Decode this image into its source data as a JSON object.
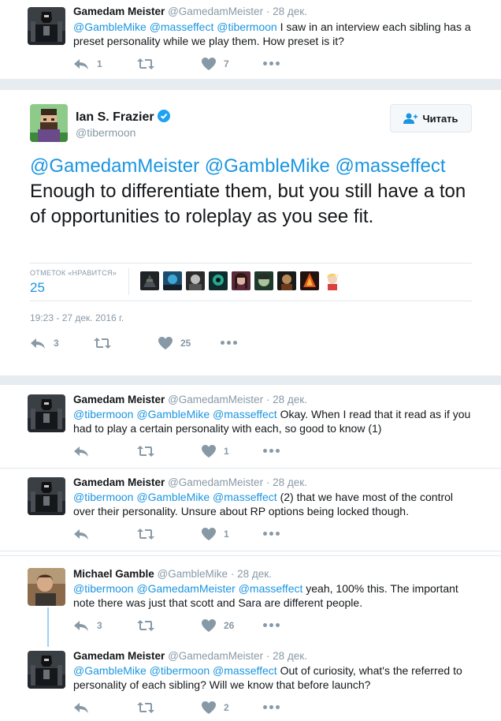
{
  "colors": {
    "link": "#1b95e0",
    "meta": "#8899a6",
    "like": "#8899a6",
    "border": "#e1e8ed",
    "verified": "#1da1f2"
  },
  "reply0": {
    "name": "Gamedam Meister",
    "handle": "@GamedamMeister",
    "sep": "·",
    "date": "28 дек.",
    "mentions": [
      "@GambleMike",
      "@masseffect",
      "@tibermoon"
    ],
    "text": "I saw in an interview each sibling has a preset personality while we play them. How preset is it?",
    "counts": {
      "reply": "1",
      "retweet": "",
      "like": "7"
    }
  },
  "main": {
    "name": "Ian S. Frazier",
    "handle": "@tibermoon",
    "verified_icon": "verified-badge-icon",
    "follow_label": "Читать",
    "mentions": [
      "@GamedamMeister",
      "@GambleMike",
      "@masseffect"
    ],
    "text": "Enough to differentiate them, but you still have a ton of opportunities to roleplay as you see fit.",
    "likes_label": "ОТМЕТОК «НРАВИТСЯ»",
    "likes_count": "25",
    "timestamp": "19:23 - 27 дек. 2016 г.",
    "counts": {
      "reply": "3",
      "retweet": "",
      "like": "25"
    }
  },
  "reply1": {
    "name": "Gamedam Meister",
    "handle": "@GamedamMeister",
    "sep": "·",
    "date": "28 дек.",
    "mentions": [
      "@tibermoon",
      "@GambleMike",
      "@masseffect"
    ],
    "text": "Okay. When I read that it read as if you had to play a certain personality with each, so good to know (1)",
    "counts": {
      "reply": "",
      "retweet": "",
      "like": "1"
    }
  },
  "reply2": {
    "name": "Gamedam Meister",
    "handle": "@GamedamMeister",
    "sep": "·",
    "date": "28 дек.",
    "mentions": [
      "@tibermoon",
      "@GambleMike",
      "@masseffect"
    ],
    "text": "(2) that we have most of the control over their personality. Unsure about RP options being locked though.",
    "counts": {
      "reply": "",
      "retweet": "",
      "like": "1"
    }
  },
  "reply3": {
    "name": "Michael Gamble",
    "handle": "@GambleMike",
    "sep": "·",
    "date": "28 дек.",
    "mentions": [
      "@tibermoon",
      "@GamedamMeister",
      "@masseffect"
    ],
    "text": "yeah, 100% this. The important note there was just that scott and Sara are different people.",
    "counts": {
      "reply": "3",
      "retweet": "",
      "like": "26"
    }
  },
  "reply4": {
    "name": "Gamedam Meister",
    "handle": "@GamedamMeister",
    "sep": "·",
    "date": "28 дек.",
    "mentions": [
      "@GambleMike",
      "@tibermoon",
      "@masseffect"
    ],
    "text": "Out of curiosity, what's the referred to personality of each sibling? Will we know that before launch?",
    "counts": {
      "reply": "",
      "retweet": "",
      "like": "2"
    }
  }
}
